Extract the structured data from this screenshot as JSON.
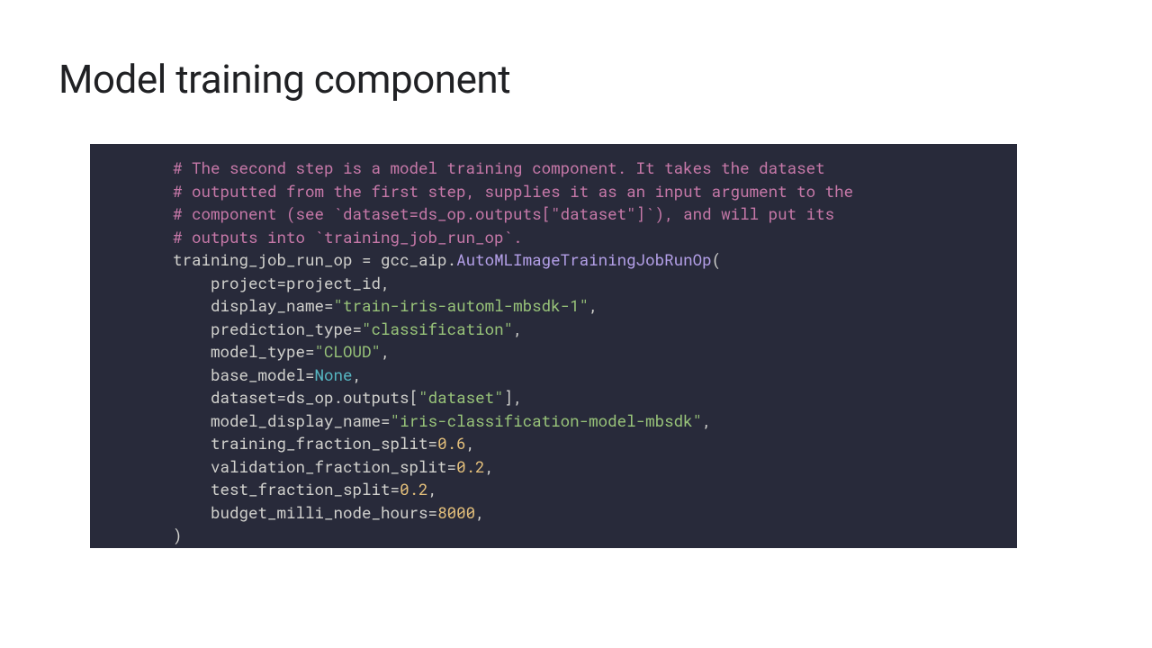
{
  "title": "Model training component",
  "code": {
    "c1": "# The second step is a model training component. It takes the dataset",
    "c2": "# outputted from the first step, supplies it as an input argument to the",
    "c3": "# component (see `dataset=ds_op.outputs[\"dataset\"]`), and will put its",
    "c4": "# outputs into `training_job_run_op`.",
    "assign_lhs": "training_job_run_op = gcc_aip.",
    "class_name": "AutoMLImageTrainingJobRunOp",
    "open_paren": "(",
    "indent": "    ",
    "p_project": "project=project_id,",
    "p_display_name_k": "display_name=",
    "p_display_name_v": "\"train-iris-automl-mbsdk-1\"",
    "p_prediction_type_k": "prediction_type=",
    "p_prediction_type_v": "\"classification\"",
    "p_model_type_k": "model_type=",
    "p_model_type_v": "\"CLOUD\"",
    "p_base_model_k": "base_model=",
    "p_base_model_v": "None",
    "p_dataset_k": "dataset=ds_op.outputs[",
    "p_dataset_v": "\"dataset\"",
    "p_dataset_tail": "],",
    "p_model_display_name_k": "model_display_name=",
    "p_model_display_name_v": "\"iris-classification-model-mbsdk\"",
    "p_train_split_k": "training_fraction_split=",
    "p_train_split_v": "0.6",
    "p_val_split_k": "validation_fraction_split=",
    "p_val_split_v": "0.2",
    "p_test_split_k": "test_fraction_split=",
    "p_test_split_v": "0.2",
    "p_budget_k": "budget_milli_node_hours=",
    "p_budget_v": "8000",
    "comma": ",",
    "close_paren": ")"
  }
}
